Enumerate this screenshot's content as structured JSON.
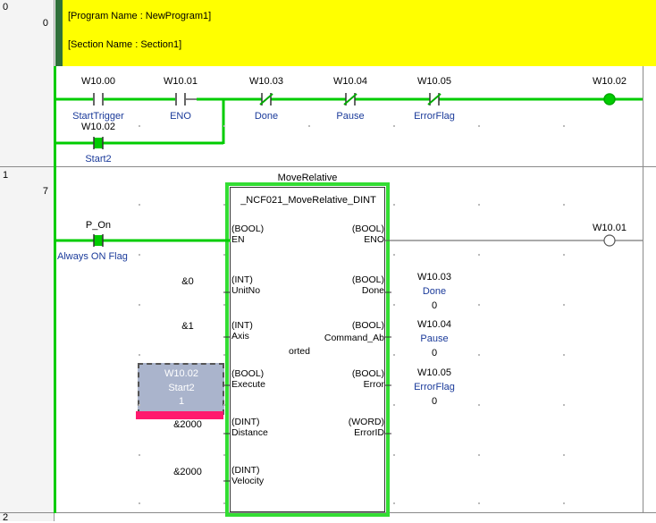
{
  "rungs": {
    "r0": {
      "rung": "0",
      "step": "0"
    },
    "r1": {
      "rung": "1",
      "step": "7"
    },
    "r2": {
      "rung": "2"
    }
  },
  "comment": {
    "program": "[Program Name : NewProgram1]",
    "section": "[Section Name : Section1]"
  },
  "rung0": {
    "c1": {
      "addr": "W10.00",
      "name": "StartTrigger"
    },
    "c2": {
      "addr": "W10.01",
      "name": "ENO"
    },
    "c3": {
      "addr": "W10.03",
      "name": "Done"
    },
    "c4": {
      "addr": "W10.04",
      "name": "Pause"
    },
    "c5": {
      "addr": "W10.05",
      "name": "ErrorFlag"
    },
    "c6": {
      "addr": "W10.02",
      "name": "Start2"
    },
    "coil": {
      "addr": "W10.02"
    }
  },
  "rung1": {
    "block_title": "MoveRelative",
    "block_type": "_NCF021_MoveRelative_DINT",
    "contact": {
      "addr": "P_On",
      "name": "Always ON Flag"
    },
    "coil": {
      "addr": "W10.01"
    },
    "inputs": {
      "en": {
        "type": "(BOOL)",
        "pin": "EN"
      },
      "unitno": {
        "type": "(INT)",
        "pin": "UnitNo",
        "value": "&0"
      },
      "axis": {
        "type": "(INT)",
        "pin": "Axis",
        "value": "&1"
      },
      "execute": {
        "type": "(BOOL)",
        "pin": "Execute",
        "addr": "W10.02",
        "name": "Start2",
        "value": "1"
      },
      "distance": {
        "type": "(DINT)",
        "pin": "Distance",
        "value": "&2000"
      },
      "velocity": {
        "type": "(DINT)",
        "pin": "Velocity",
        "value": "&2000"
      }
    },
    "outputs": {
      "eno": {
        "type": "(BOOL)",
        "pin": "ENO"
      },
      "done": {
        "type": "(BOOL)",
        "pin": "Done",
        "addr": "W10.03",
        "name": "Done",
        "value": "0"
      },
      "aborted": {
        "type": "(BOOL)",
        "pin1": "Command_Ab",
        "pin2": "orted",
        "addr": "W10.04",
        "name": "Pause",
        "value": "0"
      },
      "error": {
        "type": "(BOOL)",
        "pin": "Error",
        "addr": "W10.05",
        "name": "ErrorFlag",
        "value": "0"
      },
      "errorid": {
        "type": "(WORD)",
        "pin": "ErrorID"
      }
    }
  },
  "colors": {
    "energized": "#00cc00",
    "comment_bg": "#ffff00",
    "selection": "#aab4cc",
    "marker": "#ff1a6e"
  }
}
